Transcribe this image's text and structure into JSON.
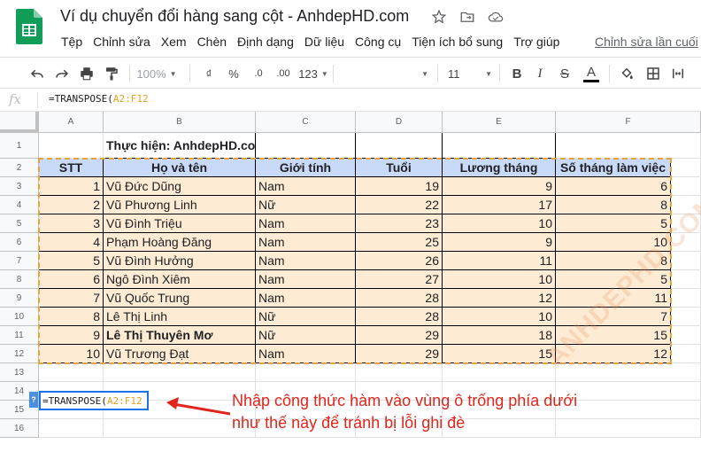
{
  "app": {
    "doc_title": "Ví dụ chuyển đổi hàng sang cột - AnhdepHD.com",
    "last_edit": "Chỉnh sửa lần cuối",
    "menu": [
      "Tệp",
      "Chỉnh sửa",
      "Xem",
      "Chèn",
      "Định dạng",
      "Dữ liệu",
      "Công cụ",
      "Tiện ích bổ sung",
      "Trợ giúp"
    ]
  },
  "toolbar": {
    "zoom": "100%",
    "currency": "₫",
    "percent": "%",
    "dec_less": ".0",
    "dec_more": ".00",
    "more_formats": "123",
    "font_size": "11",
    "bold": "B",
    "italic": "I",
    "strike": "S",
    "text_color": "A"
  },
  "formula_bar": {
    "fx": "fx",
    "prefix": "=TRANSPOSE(",
    "range": "A2:F12"
  },
  "columns": [
    "A",
    "B",
    "C",
    "D",
    "E",
    "F"
  ],
  "rows": [
    "1",
    "2",
    "3",
    "4",
    "5",
    "6",
    "7",
    "8",
    "9",
    "10",
    "11",
    "12",
    "13",
    "14",
    "15",
    "16"
  ],
  "sheet": {
    "b1": "Thực hiện: AnhdepHD.com",
    "headers": [
      "STT",
      "Họ và tên",
      "Giới tính",
      "Tuổi",
      "Lương tháng",
      "Số tháng làm việc"
    ],
    "records": [
      [
        "1",
        "Vũ Đức Dũng",
        "Nam",
        "19",
        "9",
        "6"
      ],
      [
        "2",
        "Vũ Phương Linh",
        "Nữ",
        "22",
        "17",
        "8"
      ],
      [
        "3",
        "Vũ Đình Triệu",
        "Nam",
        "23",
        "10",
        "5"
      ],
      [
        "4",
        "Phạm Hoàng Đăng",
        "Nam",
        "25",
        "9",
        "10"
      ],
      [
        "5",
        "Vũ Đình Hưởng",
        "Nam",
        "26",
        "11",
        "8"
      ],
      [
        "6",
        "Ngô Đình Xiêm",
        "Nam",
        "27",
        "10",
        "5"
      ],
      [
        "7",
        "Vũ Quốc Trung",
        "Nam",
        "28",
        "12",
        "11"
      ],
      [
        "8",
        "Lê Thị Linh",
        "Nữ",
        "28",
        "10",
        "7"
      ],
      [
        "9",
        "Lê Thị Thuyên Mơ",
        "Nữ",
        "29",
        "18",
        "15"
      ],
      [
        "10",
        "Vũ Trương Đạt",
        "Nam",
        "29",
        "15",
        "12"
      ]
    ],
    "a14_prefix": "=TRANSPOSE(",
    "a14_range": "A2:F12",
    "help_badge": "?"
  },
  "annotation": {
    "line1": "Nhập công thức hàm vào vùng ô trống phía dưới",
    "line2": "như thế này để tránh bị lỗi ghi đè"
  },
  "watermark": "ANHDEPHD.COM",
  "colors": {
    "header_fill": "#c9daf8",
    "data_fill": "#fdebd3",
    "selection_dash": "#e6a23c",
    "annotation_red": "#e1251b",
    "active_blue": "#1a73e8",
    "sheets_green": "#0f9d58"
  }
}
